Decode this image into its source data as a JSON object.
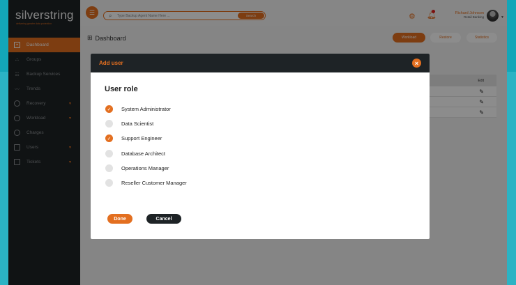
{
  "app": {
    "logo": "silverstring",
    "tagline": "delivering greater data protection"
  },
  "sidebar": {
    "items": [
      {
        "label": "Dashboard",
        "icon": "dashboard-icon",
        "active": true,
        "caret": ""
      },
      {
        "label": "Groups",
        "icon": "groups-icon",
        "active": false,
        "caret": ""
      },
      {
        "label": "Backup Services",
        "icon": "backup-icon",
        "active": false,
        "caret": ""
      },
      {
        "label": "Trends",
        "icon": "trends-icon",
        "active": false,
        "caret": ""
      },
      {
        "label": "Recovery",
        "icon": "recovery-icon",
        "active": false,
        "caret": "▼"
      },
      {
        "label": "Workload",
        "icon": "workload-icon",
        "active": false,
        "caret": "▼"
      },
      {
        "label": "Charges",
        "icon": "charges-icon",
        "active": false,
        "caret": ""
      },
      {
        "label": "Users",
        "icon": "users-icon",
        "active": false,
        "caret": "▼"
      },
      {
        "label": "Tickets",
        "icon": "tickets-icon",
        "active": false,
        "caret": "▼"
      }
    ]
  },
  "header": {
    "search_placeholder": "Type Backup Agent Name Here ...",
    "search_button": "Search",
    "user_name": "Richard Johnson",
    "user_role": "Retail Banking"
  },
  "page": {
    "title": "Dashboard",
    "buttons": {
      "workload": "Workload",
      "restore": "Restore",
      "statistics": "Statistics"
    },
    "table": {
      "edit_header": "Edit"
    }
  },
  "modal": {
    "title": "Add user",
    "section_title": "User role",
    "roles": [
      {
        "label": "System Administrator",
        "checked": true
      },
      {
        "label": "Data Scientist",
        "checked": false
      },
      {
        "label": "Support Engineer",
        "checked": true
      },
      {
        "label": "Database Architect",
        "checked": false
      },
      {
        "label": "Operations Manager",
        "checked": false
      },
      {
        "label": "Reseller Customer Manager",
        "checked": false
      }
    ],
    "done_label": "Done",
    "cancel_label": "Cancel"
  },
  "colors": {
    "accent": "#e36f20",
    "dark": "#1e2326",
    "teal": "#13a6b8"
  }
}
